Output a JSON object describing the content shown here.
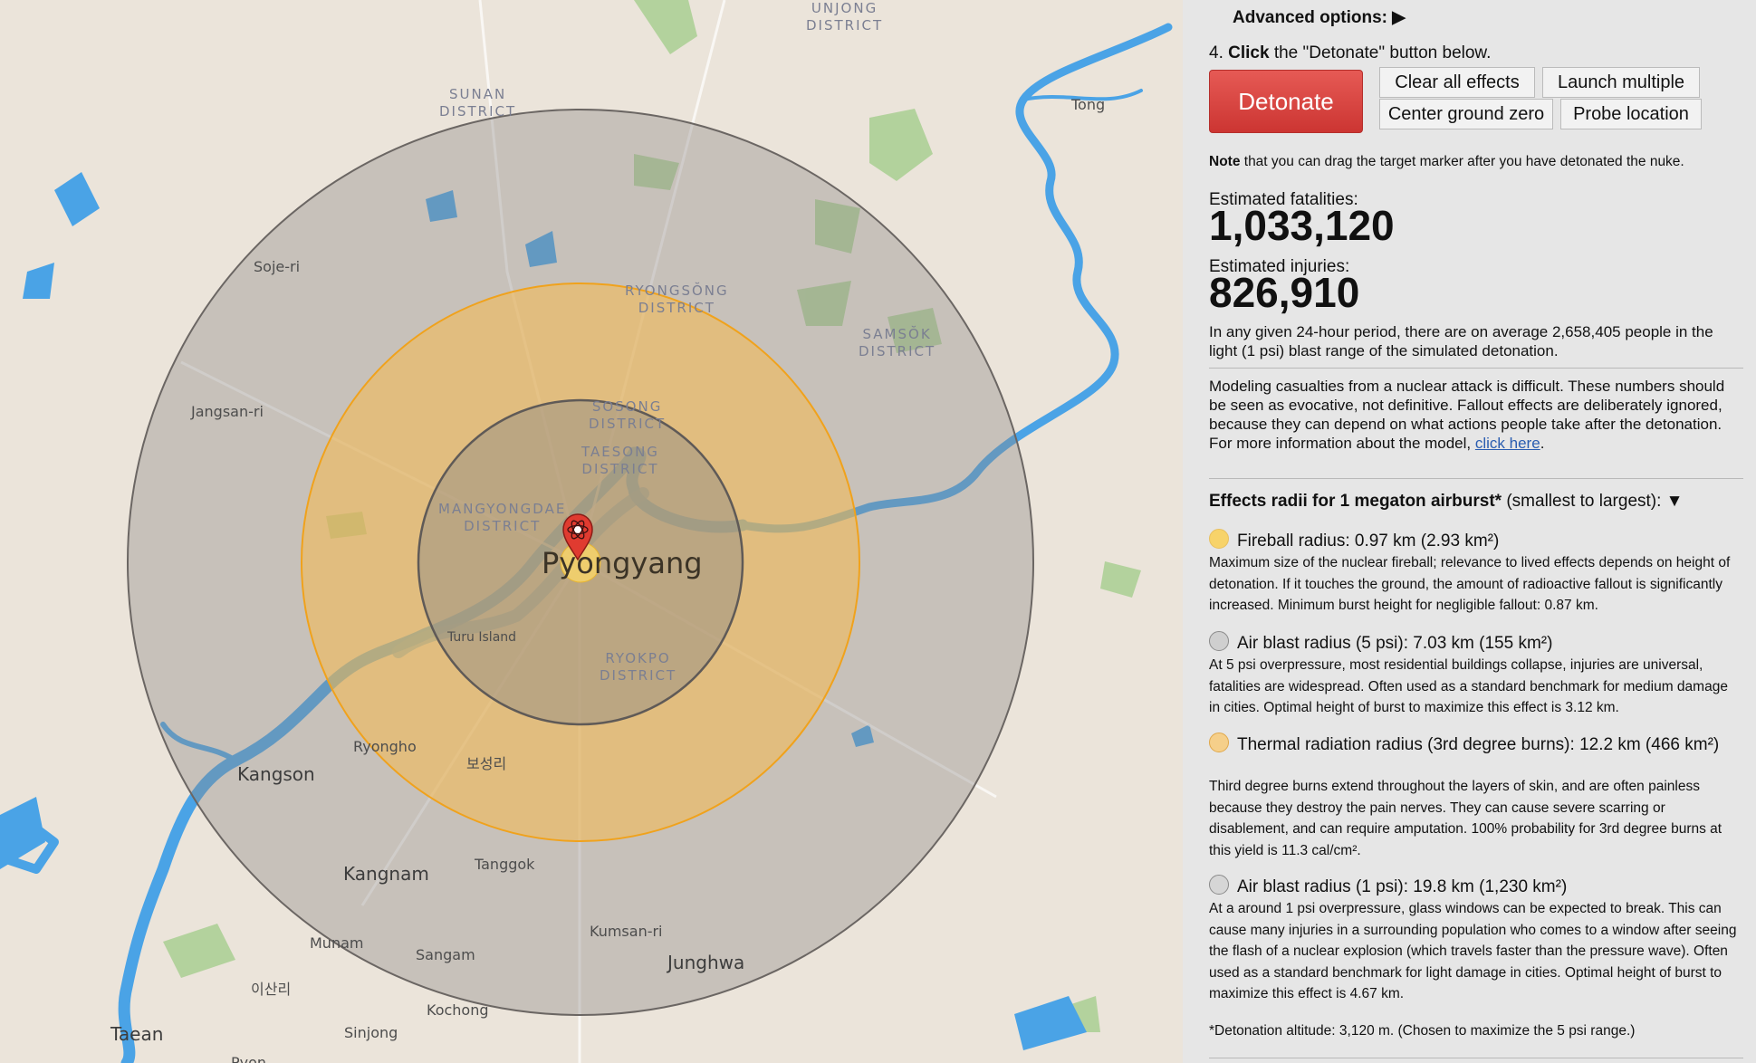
{
  "map": {
    "places": {
      "yongung": "UNJONG\nDISTRICT",
      "sunan": "SUNAN\nDISTRICT",
      "ryongsong": "RYONGSŎNG\nDISTRICT",
      "samsok": "SAMSŎK\nDISTRICT",
      "sosong": "SOSONG\nDISTRICT",
      "taesong": "TAESONG\nDISTRICT",
      "mangyongdae": "MANGYONGDAE\nDISTRICT",
      "ryokpo": "RYOKPO\nDISTRICT",
      "pyongyang": "Pyongyang",
      "tong": "Tong",
      "soje": "Soje-ri",
      "jangsan": "Jangsan-ri",
      "turu": "Turu Island",
      "ryongho": "Ryongho",
      "kangson": "Kangson",
      "bosong": "보성리",
      "kangnam": "Kangnam",
      "tanggok": "Tanggok",
      "kumsan": "Kumsan-ri",
      "munam": "Munam",
      "sangam": "Sangam",
      "junghwa": "Junghwa",
      "isan": "이산리",
      "kochong": "Kochong",
      "taean": "Taean",
      "sinjong": "Sinjong",
      "pyon": "Pyon"
    },
    "colors": {
      "thermal_fill": "#f5b94f",
      "thermal_stroke": "#f0a21c",
      "blast_fill": "#8e8a87",
      "blast_stroke": "#6b6663",
      "water": "#4aa3e6",
      "park": "#9cc58a"
    },
    "marker_icon": "atom-pin-icon"
  },
  "panel": {
    "advanced": "Advanced options: ▶",
    "step_prefix": "4. ",
    "step_bold": "Click",
    "step_rest": " the \"Detonate\" button below.",
    "detonate": "Detonate",
    "clear": "Clear all effects",
    "launch": "Launch multiple",
    "center": "Center ground zero",
    "probe": "Probe location",
    "note_bold": "Note",
    "note_rest": " that you can drag the target marker after you have detonated the nuke.",
    "fatalities_label": "Estimated fatalities:",
    "fatalities": "1,033,120",
    "injuries_label": "Estimated injuries:",
    "injuries": "826,910",
    "daily": "In any given 24-hour period, there are on average 2,658,405 people in the light (1 psi) blast range of the simulated detonation.",
    "modeling": "Modeling casualties from a nuclear attack is difficult. These numbers should be seen as evocative, not definitive. Fallout effects are deliberately ignored, because they can depend on what actions people take after the detonation. For more information about the model, ",
    "modeling_link": "click here",
    "effects_head_bold": "Effects radii for 1 megaton airburst*",
    "effects_head_rest": " (smallest to largest): ▼",
    "effects": [
      {
        "title": "Fireball radius: 0.97 km (2.93 km²)",
        "desc": "Maximum size of the nuclear fireball; relevance to lived effects depends on height of detonation. If it touches the ground, the amount of radioactive fallout is significantly increased. Minimum burst height for negligible fallout: 0.87 km.",
        "color": "#f7d36a"
      },
      {
        "title": "Air blast radius (5 psi): 7.03 km (155 km²)",
        "desc": "At 5 psi overpressure, most residential buildings collapse, injuries are universal, fatalities are widespread. Often used as a standard benchmark for medium damage in cities. Optimal height of burst to maximize this effect is 3.12 km.",
        "color": "#cfcfcf"
      },
      {
        "title": "Thermal radiation radius (3rd degree burns): 12.2 km (466 km²)",
        "desc": "Third degree burns extend throughout the layers of skin, and are often painless because they destroy the pain nerves. They can cause severe scarring or disablement, and can require amputation. 100% probability for 3rd degree burns at this yield is 11.3 cal/cm².",
        "color": "#f5cf8a"
      },
      {
        "title": "Air blast radius (1 psi): 19.8 km (1,230 km²)",
        "desc": "At a around 1 psi overpressure, glass windows can be expected to break. This can cause many injuries in a surrounding population who comes to a window after seeing the flash of a nuclear explosion (which travels faster than the pressure wave). Often used as a standard benchmark for light damage in cities. Optimal height of burst to maximize this effect is 4.67 km.",
        "color": "#d6d6d6"
      }
    ],
    "footnote": "*Detonation altitude: 3,120 m. (Chosen to maximize the 5 psi range.)"
  }
}
